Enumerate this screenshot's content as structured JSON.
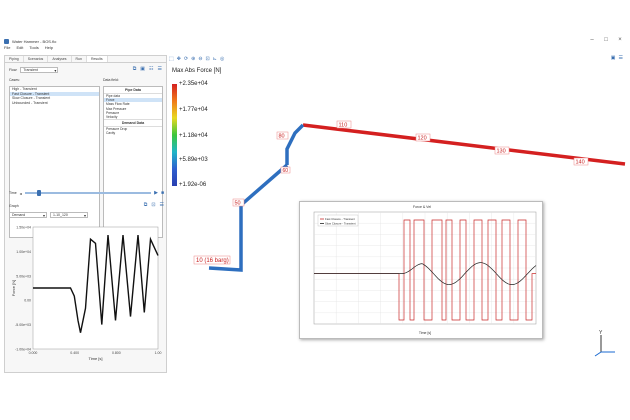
{
  "window": {
    "title": "Water Hammer - BOS.flo",
    "min": "–",
    "max": "□",
    "close": "×"
  },
  "menu": [
    "File",
    "Edit",
    "Tools",
    "Help"
  ],
  "left_tabs": [
    "Piping",
    "Scenarios",
    "Analyses",
    "Run",
    "Results"
  ],
  "flow": {
    "label": "Flow:",
    "value": "Transient"
  },
  "cases": {
    "label": "Cases:",
    "items": [
      "High - Transient",
      "Fast Closure - Transient",
      "Slow Closure - Transient",
      "Unbounded - Transient"
    ],
    "selected": 1
  },
  "pipe_data": {
    "label": "Data field:",
    "header": "Pipe Data",
    "items": [
      "Pipe data",
      "Force",
      "Mass Flow Rate",
      "Max Pressure",
      "Pressure",
      "Velocity"
    ],
    "highlighted": 1,
    "sub_header": "Demand Data",
    "sub_items": [
      "Pressure Drop",
      "Cavity"
    ]
  },
  "time": {
    "label": "Time"
  },
  "graph": {
    "title": "Graph",
    "series_select": "Demand",
    "point_select": "1-10_120"
  },
  "legend": {
    "title": "Max Abs Force [N]",
    "labels": [
      "+2.35e+04",
      "+1.77e+04",
      "+1.18e+04",
      "+5.89e+03",
      "+1.92e-06"
    ]
  },
  "pipe_labels": [
    "10 (16 barg)",
    "50",
    "60",
    "80",
    "110",
    "120",
    "130",
    "140"
  ],
  "colors": {
    "accent": "#3a6fb0",
    "pipe_red": "#d42020",
    "pipe_blue": "#2e6fbf",
    "selection": "#cfe3f7"
  },
  "chart_data": [
    {
      "type": "line",
      "title": "",
      "xlabel": "Time [s]",
      "ylabel": "Force [N]",
      "xlim": [
        0,
        1.0
      ],
      "ylim": [
        -1.5,
        1.5
      ],
      "x_ticks": [
        "0.000",
        "0.400",
        "0.800",
        "1.00"
      ],
      "y_ticks": [
        "1.50e+04",
        "1.00e+04",
        "5.00e+03",
        "0.00",
        "-5.00e+03",
        "-1.00e+04"
      ],
      "series": [
        {
          "x": [
            0,
            0.3,
            0.33,
            0.36,
            0.38,
            0.42,
            0.46,
            0.5,
            0.55,
            0.6,
            0.66,
            0.72,
            0.78,
            0.84,
            0.89,
            0.94,
            1.0
          ],
          "values": [
            0,
            0,
            -0.2,
            -0.8,
            -1.1,
            -0.5,
            1.2,
            1.1,
            -0.9,
            1.3,
            -0.8,
            1.3,
            -0.7,
            1.3,
            -0.6,
            1.2,
            0.8
          ]
        }
      ]
    },
    {
      "type": "line",
      "title": "Force & Vel",
      "xlabel": "Time [s]",
      "ylabel": "",
      "legend_entries": [
        "Fast Closure - Transient",
        "Slow Closure - Transient"
      ],
      "legend_placement": "top-left",
      "series": [
        {
          "name": "Fast Closure - Transient",
          "color": "#c92a2a"
        },
        {
          "name": "Slow Closure - Transient",
          "color": "#222222"
        }
      ]
    }
  ]
}
